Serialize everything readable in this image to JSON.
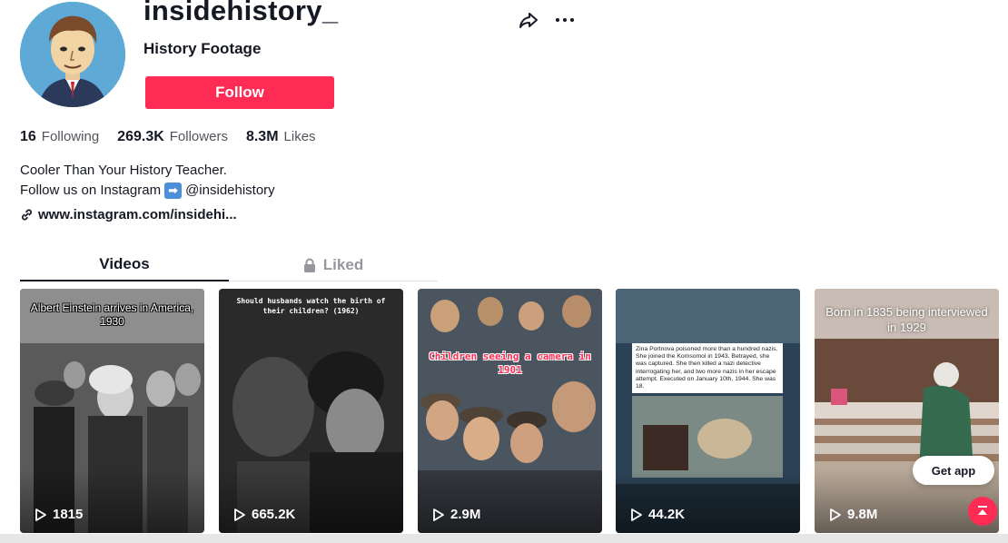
{
  "profile": {
    "username": "insidehistory_",
    "nickname": "History Footage",
    "follow_label": "Follow"
  },
  "stats": [
    {
      "value": "16",
      "label": "Following"
    },
    {
      "value": "269.3K",
      "label": "Followers"
    },
    {
      "value": "8.3M",
      "label": "Likes"
    }
  ],
  "bio": {
    "line1": "Cooler Than Your History Teacher.",
    "line2_prefix": "Follow us on Instagram",
    "line2_emoji": "➡",
    "line2_handle": "@insidehistory",
    "link": "www.instagram.com/insidehi..."
  },
  "tabs": [
    {
      "label": "Videos",
      "active": true
    },
    {
      "label": "Liked",
      "active": false,
      "icon": "lock-icon"
    }
  ],
  "videos": [
    {
      "caption": "Albert Einstein arrives in America, 1930",
      "views": "1815"
    },
    {
      "caption": "Should husbands watch the birth of their children? (1962)",
      "views": "665.2K"
    },
    {
      "caption": "Children seeing a camera in 1901",
      "views": "2.9M"
    },
    {
      "caption": "Zina Portnova poisoned more than a hundred nazis. She joined the Komsomol in 1943. Betrayed, she was captured. She then killed a nazi detective interrogating her, and two more nazis in her escape attempt. Executed on January 10th, 1944. She was 18.",
      "views": "44.2K"
    },
    {
      "caption": "Born in 1835 being interviewed in 1929",
      "views": "9.8M"
    }
  ],
  "get_app_label": "Get app",
  "colors": {
    "accent": "#fe2c55",
    "text": "#161823"
  }
}
